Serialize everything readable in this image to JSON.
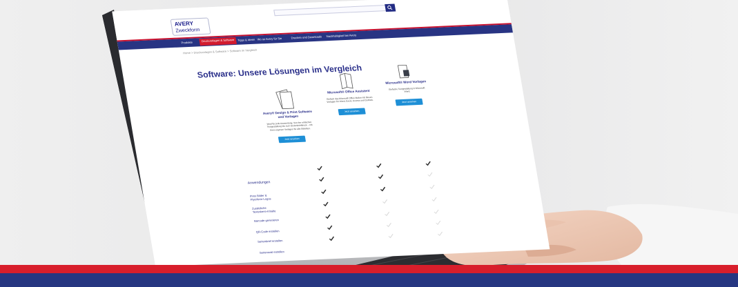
{
  "site": {
    "logo_line1": "AVERY",
    "logo_line2": "Zweckform",
    "nav": [
      "Produkte",
      "Druckvorlagen & Software",
      "Tipps & Ideen",
      "Wo ist Avery für Sie",
      "Drucken und Downloads",
      "Nachhaltigkeit bei Avery"
    ],
    "breadcrumb": "Home  >  Druckvorlagen & Software  >  Software im Vergleich",
    "page_title": "Software: Unsere Lösungen im Vergleich",
    "columns": [
      {
        "title": "Avery® Design & Print Software und Vorlagen",
        "desc": "Ideal für jede Anwendung: Von der einfachen Textgestaltung bis zum Serienbriefdruck – mit Ihren eigenen Vorlagen für alle Etiketten.",
        "button": "Jetzt ansehen"
      },
      {
        "title": "Microsoft® Office Assistent",
        "desc": "Einfach das Microsoft Office Makro mit diesen Vorlagen für Word, Excel, Access und Outlook.",
        "button": "Jetzt ansehen"
      },
      {
        "title": "Microsoft® Word Vorlagen",
        "desc": "Einfache Textgestaltung in Microsoft Word.",
        "button": "Jetzt ansehen"
      }
    ],
    "features_heading": "Anwendungen",
    "features": [
      "Ihres Bilder & Flyerform-Logos",
      "Zusätzliche Texterkenn-Inhalte",
      "Barcode generieren",
      "QR-Code erstellen",
      "Serienbrief erstellen",
      "Serienmail erstellen"
    ]
  },
  "colors": {
    "brand_red": "#d81e2b",
    "brand_blue": "#263681",
    "link_blue": "#1e8fd6"
  }
}
